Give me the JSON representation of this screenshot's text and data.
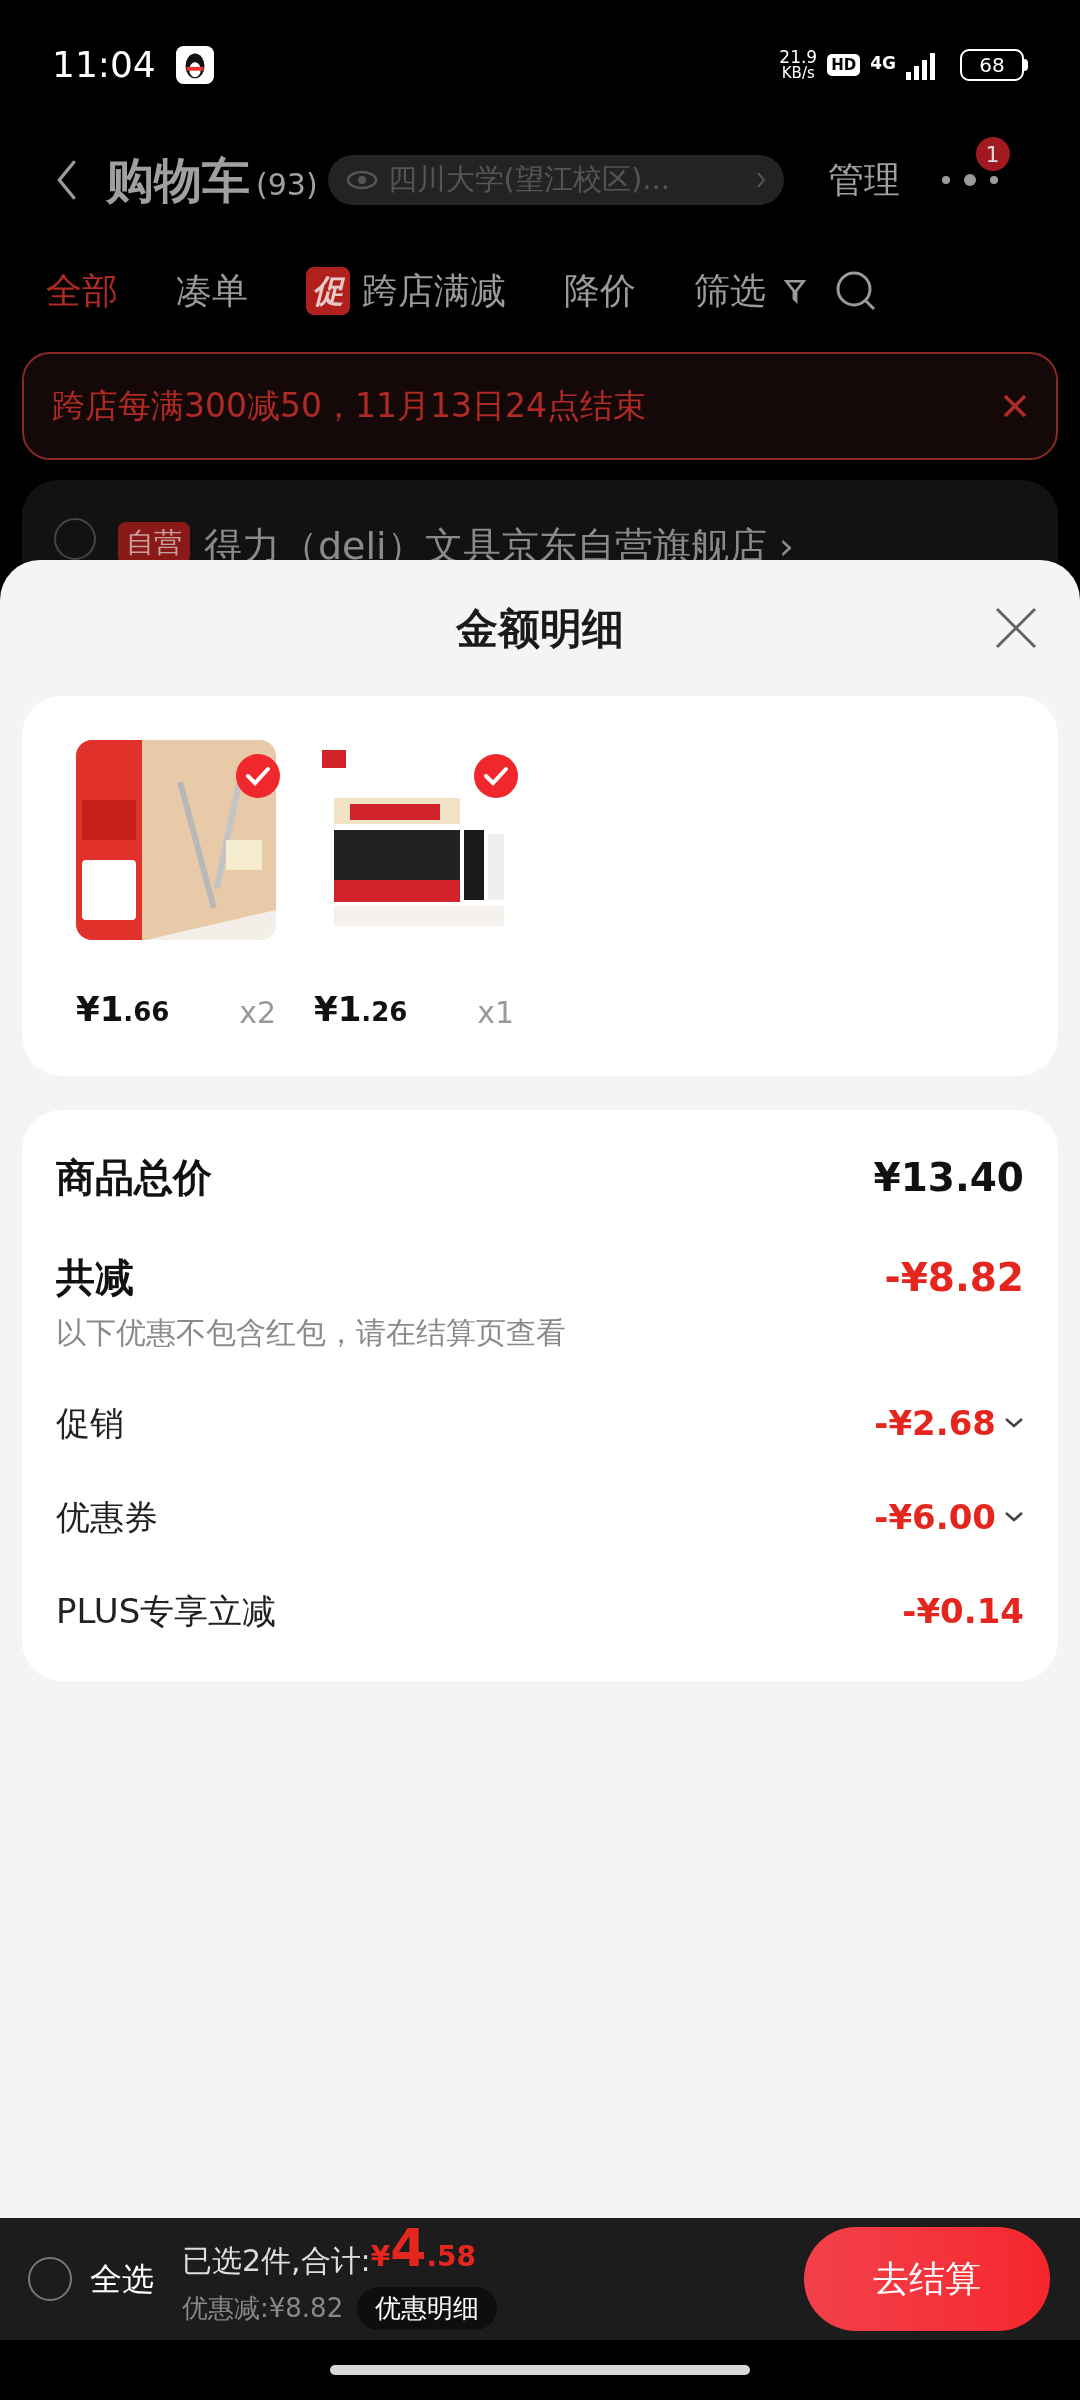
{
  "status_bar": {
    "time": "11:04",
    "speed": "21.9",
    "speed_unit": "KB/s",
    "hd": "HD",
    "network": "4G",
    "battery": "68"
  },
  "header": {
    "title": "购物车",
    "count": "(93)",
    "address": "四川大学(望江校区)...",
    "manage": "管理",
    "badge": "1"
  },
  "tabs": [
    {
      "label": "全部",
      "selected": true
    },
    {
      "label": "凑单",
      "selected": false
    },
    {
      "label": "跨店满减",
      "tag": "促",
      "selected": false
    },
    {
      "label": "降价",
      "selected": false
    },
    {
      "label": "筛选",
      "kind": "filter",
      "selected": false
    }
  ],
  "banner": {
    "text": "跨店每满300减50，11月13日24点结束"
  },
  "store": {
    "tag": "自营",
    "name": "得力（deli）文具京东自营旗舰店 ›",
    "checked": false
  },
  "sheet": {
    "title": "金额明细",
    "items": [
      {
        "kind": "picture",
        "currency": "¥",
        "price_main": "1",
        "price_decimal": ".66",
        "quantity": "x2",
        "selected": true
      },
      {
        "kind": "picture",
        "currency": "¥",
        "price_main": "1",
        "price_decimal": ".26",
        "quantity": "x1",
        "selected": true
      }
    ],
    "total": {
      "label": "商品总价",
      "value": "¥13.40"
    },
    "discount": {
      "label": "共减",
      "value": "-¥8.82",
      "note": "以下优惠不包含红包，请在结算页查看"
    },
    "rows": [
      {
        "label": "促销",
        "value": "-¥2.68",
        "expandable": true
      },
      {
        "label": "优惠券",
        "value": "-¥6.00",
        "expandable": true
      },
      {
        "label": "PLUS专享立减",
        "value": "-¥0.14",
        "expandable": false
      }
    ]
  },
  "footer": {
    "select_all": "全选",
    "checked": false,
    "selected_text": "已选2件,合计:",
    "currency": "¥",
    "total_main": "4",
    "total_decimal": ".58",
    "saved": "优惠减:¥8.82",
    "details": "优惠明细",
    "checkout": "去结算"
  }
}
